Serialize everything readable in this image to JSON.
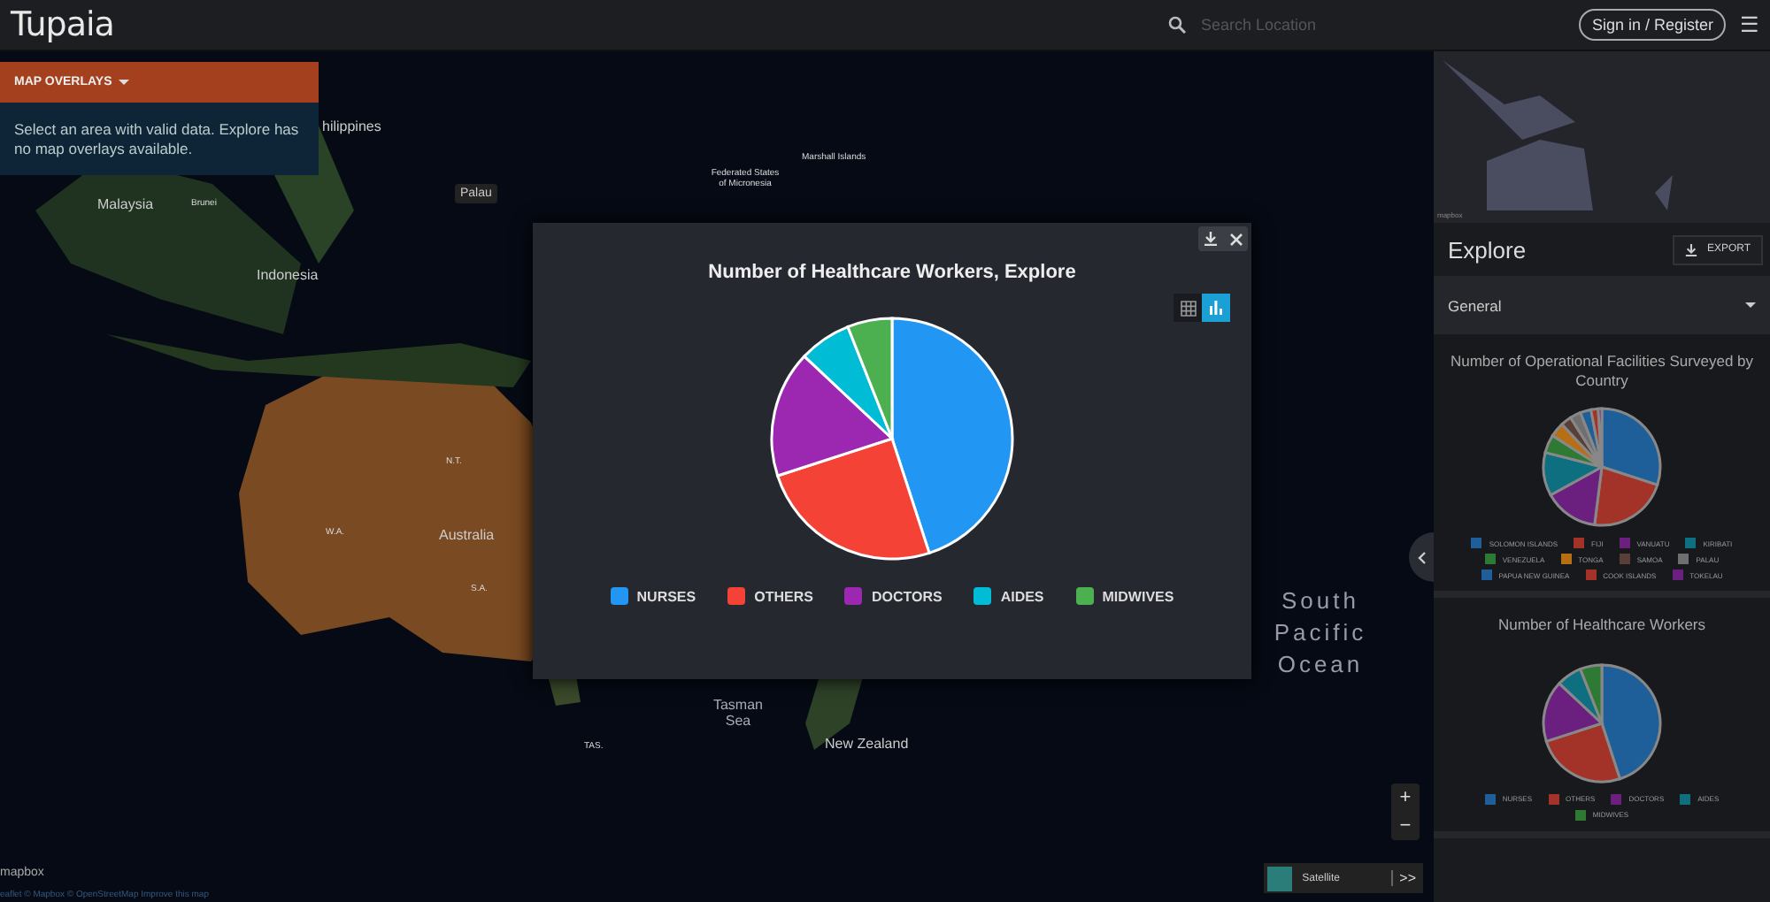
{
  "header": {
    "logo": "Tupaia",
    "search": {
      "placeholder": "Search Location"
    },
    "sign_in": "Sign in / Register",
    "menu": "☰"
  },
  "overlay_panel": {
    "title": "MAP OVERLAYS",
    "message": "Select an area with valid data. Explore has no map overlays available."
  },
  "map": {
    "labels": [
      {
        "text": "hilippines",
        "kind": "country"
      },
      {
        "text": "Malaysia",
        "kind": "country"
      },
      {
        "text": "Brunei",
        "kind": "small"
      },
      {
        "text": "Palau",
        "kind": "tag"
      },
      {
        "text": "Federated States of Micronesia",
        "kind": "small"
      },
      {
        "text": "Marshall Islands",
        "kind": "small"
      },
      {
        "text": "Indonesia",
        "kind": "country"
      },
      {
        "text": "N.T.",
        "kind": "small"
      },
      {
        "text": "W.A.",
        "kind": "small"
      },
      {
        "text": "Australia",
        "kind": "country"
      },
      {
        "text": "S.A.",
        "kind": "small"
      },
      {
        "text": "TAS.",
        "kind": "small"
      },
      {
        "text": "Tasman Sea",
        "kind": "sea"
      },
      {
        "text": "New Zealand",
        "kind": "country"
      },
      {
        "text": "South Pacific Ocean",
        "kind": "ocean"
      }
    ],
    "mapbox": "mapbox",
    "attribution": "eaflet © Mapbox © OpenStreetMap Improve this map",
    "zoom_in": "+",
    "zoom_out": "−",
    "layer": "Satellite",
    "layer_toggle": ">>"
  },
  "modal": {
    "title": "Number of Healthcare Workers, Explore",
    "view_tabs": [
      {
        "kind": "table",
        "selected": false
      },
      {
        "kind": "chart",
        "selected": true
      }
    ],
    "legend": [
      {
        "label": "NURSES",
        "color": "#2196f3"
      },
      {
        "label": "OTHERS",
        "color": "#f44336"
      },
      {
        "label": "DOCTORS",
        "color": "#9c27b0"
      },
      {
        "label": "AIDES",
        "color": "#00bcd4"
      },
      {
        "label": "MIDWIVES",
        "color": "#4caf50"
      }
    ]
  },
  "sidebar": {
    "minimap_label": "mapbox",
    "title": "Explore",
    "export": "EXPORT",
    "section": "General",
    "cards": [
      {
        "title": "Number of Operational Facilities Surveyed by Country",
        "legend": [
          {
            "label": "SOLOMON ISLANDS",
            "color": "#1f5f99"
          },
          {
            "label": "FIJI",
            "color": "#a33228"
          },
          {
            "label": "VANUATU",
            "color": "#6b2080"
          },
          {
            "label": "KIRIBATI",
            "color": "#0e6f80"
          },
          {
            "label": "VENEZUELA",
            "color": "#2e7a34"
          },
          {
            "label": "TONGA",
            "color": "#b86e12"
          },
          {
            "label": "SAMOA",
            "color": "#5a3f38"
          },
          {
            "label": "PALAU",
            "color": "#6f6f6f"
          },
          {
            "label": "PAPUA NEW GUINEA",
            "color": "#1f5f99"
          },
          {
            "label": "COOK ISLANDS",
            "color": "#a33228"
          },
          {
            "label": "TOKELAU",
            "color": "#6b2080"
          }
        ]
      },
      {
        "title": "Number of Healthcare Workers",
        "legend": [
          {
            "label": "NURSES",
            "color": "#1f5f99"
          },
          {
            "label": "OTHERS",
            "color": "#a33228"
          },
          {
            "label": "DOCTORS",
            "color": "#6b2080"
          },
          {
            "label": "AIDES",
            "color": "#0e6f80"
          },
          {
            "label": "MIDWIVES",
            "color": "#2e7a34"
          }
        ]
      }
    ]
  }
}
